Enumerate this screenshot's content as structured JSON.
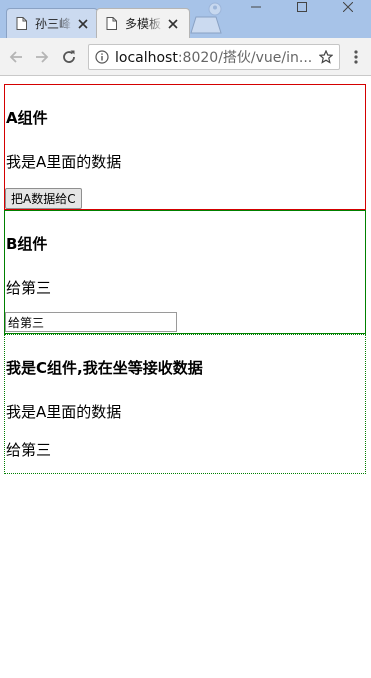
{
  "browser": {
    "tabs": [
      {
        "title": "孙三峰",
        "active": false
      },
      {
        "title": "多模板",
        "active": true
      }
    ],
    "address": {
      "host": "localhost",
      "rest": ":8020/搭伙/vue/in..."
    }
  },
  "page": {
    "component_a": {
      "heading": "A组件",
      "text": "我是A里面的数据",
      "button_label": "把A数据给C"
    },
    "component_b": {
      "heading": "B组件",
      "text": "给第三",
      "input_value": "给第三"
    },
    "component_c": {
      "heading": "我是C组件,我在坐等接收数据",
      "text_from_a": "我是A里面的数据",
      "text_from_b": "给第三"
    }
  },
  "colors": {
    "box_a_border": "#d40000",
    "box_b_border": "#008000",
    "box_c_border": "#008000"
  }
}
